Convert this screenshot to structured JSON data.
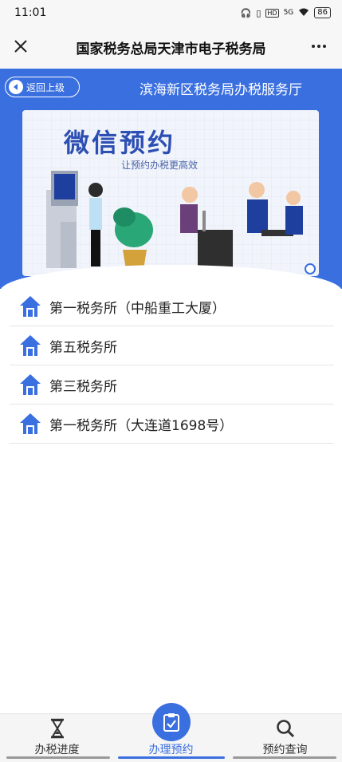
{
  "status_bar": {
    "time": "11:01",
    "battery": "86",
    "signal": "5G",
    "hd": "HD"
  },
  "nav": {
    "title": "国家税务总局天津市电子税务局"
  },
  "header": {
    "back_label": "返回上级",
    "office_name": "滨海新区税务局办税服务厅"
  },
  "banner": {
    "title": "微信预约",
    "subtitle": "让预约办税更高效"
  },
  "offices": [
    {
      "label": "第一税务所（中船重工大厦）"
    },
    {
      "label": "第五税务所"
    },
    {
      "label": "第三税务所"
    },
    {
      "label": "第一税务所（大连道1698号）"
    }
  ],
  "tabs": [
    {
      "label": "办税进度",
      "icon": "hourglass-icon"
    },
    {
      "label": "办理预约",
      "icon": "clipboard-check-icon",
      "active": true
    },
    {
      "label": "预约查询",
      "icon": "search-icon"
    }
  ],
  "colors": {
    "accent": "#3a6fe0"
  }
}
